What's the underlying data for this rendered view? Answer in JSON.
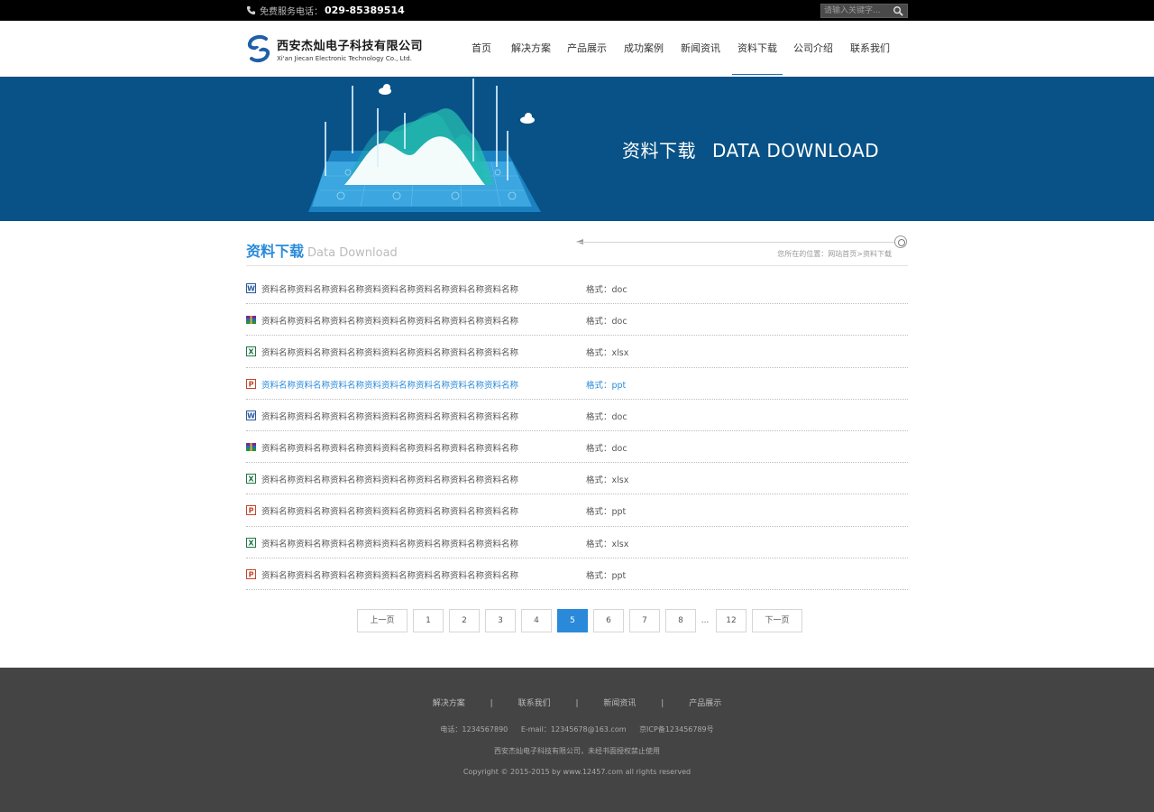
{
  "topbar": {
    "phone_label": "免费服务电话：",
    "phone_number": "029-85389514",
    "search_placeholder": "请输入关键字..."
  },
  "header": {
    "logo_cn": "西安杰灿电子科技有限公司",
    "logo_en": "Xi'an Jiecan Electronic Technology Co., Ltd.",
    "nav": [
      {
        "label": "首页"
      },
      {
        "label": "解决方案"
      },
      {
        "label": "产品展示"
      },
      {
        "label": "成功案例"
      },
      {
        "label": "新闻资讯"
      },
      {
        "label": "资料下载",
        "active": true
      },
      {
        "label": "公司介绍"
      },
      {
        "label": "联系我们"
      }
    ]
  },
  "banner": {
    "title_cn": "资料下载",
    "title_en": "DATA DOWNLOAD"
  },
  "section": {
    "title_cn": "资料下载",
    "title_en": "Data Download",
    "breadcrumb": "您所在的位置：网站首页>资料下载"
  },
  "downloads": [
    {
      "name": "资料名称资料名称资料名称资料资料名称资料名称资料名称资料名称",
      "format": "格式：doc",
      "icon": "word-icon"
    },
    {
      "name": "资料名称资料名称资料名称资料资料名称资料名称资料名称资料名称",
      "format": "格式：doc",
      "icon": "archive-icon"
    },
    {
      "name": "资料名称资料名称资料名称资料资料名称资料名称资料名称资料名称",
      "format": "格式：xlsx",
      "icon": "excel-icon"
    },
    {
      "name": "资料名称资料名称资料名称资料资料名称资料名称资料名称资料名称",
      "format": "格式：ppt",
      "icon": "powerpoint-icon",
      "highlight": true
    },
    {
      "name": "资料名称资料名称资料名称资料资料名称资料名称资料名称资料名称",
      "format": "格式：doc",
      "icon": "word-icon"
    },
    {
      "name": "资料名称资料名称资料名称资料资料名称资料名称资料名称资料名称",
      "format": "格式：doc",
      "icon": "archive-icon"
    },
    {
      "name": "资料名称资料名称资料名称资料资料名称资料名称资料名称资料名称",
      "format": "格式：xlsx",
      "icon": "excel-icon"
    },
    {
      "name": "资料名称资料名称资料名称资料资料名称资料名称资料名称资料名称",
      "format": "格式：ppt",
      "icon": "powerpoint-icon"
    },
    {
      "name": "资料名称资料名称资料名称资料资料名称资料名称资料名称资料名称",
      "format": "格式：xlsx",
      "icon": "excel-icon"
    },
    {
      "name": "资料名称资料名称资料名称资料资料名称资料名称资料名称资料名称",
      "format": "格式：ppt",
      "icon": "powerpoint-icon"
    }
  ],
  "pagination": {
    "prev": "上一页",
    "pages": [
      "1",
      "2",
      "3",
      "4",
      "5",
      "6",
      "7",
      "8"
    ],
    "ellipsis": "...",
    "last": "12",
    "next": "下一页",
    "current": "5"
  },
  "footer": {
    "nav": [
      "解决方案",
      "联系我们",
      "新闻资讯",
      "产品展示"
    ],
    "separator": "|",
    "tel": "电话：1234567890",
    "email": "E-mail：12345678@163.com",
    "icp": "京ICP备123456789号",
    "company": "西安杰灿电子科技有限公司，未经书面授权禁止使用",
    "copyright": "Copyright © 2015-2015 by www.12457.com all rights reserved"
  },
  "colors": {
    "accent": "#2a8ad9",
    "banner": "#085287",
    "footer": "#444444",
    "topbar": "#000000"
  }
}
